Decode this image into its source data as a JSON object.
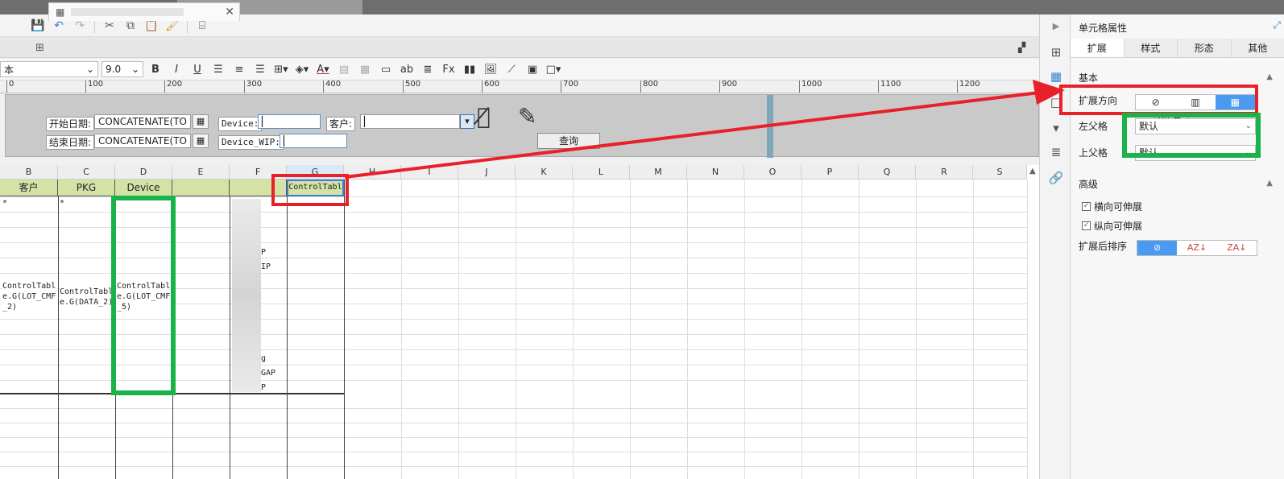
{
  "tab": {
    "title": ""
  },
  "toolbar": {
    "font_name": "本",
    "font_size": "9.0",
    "bold": "B",
    "italic": "I",
    "underline": "U"
  },
  "ruler": [
    "0",
    "100",
    "200",
    "300",
    "400",
    "500",
    "600",
    "700",
    "800",
    "900",
    "1000",
    "1100",
    "1200"
  ],
  "params": {
    "start_label": "开始日期:",
    "end_label": "结束日期:",
    "start_value": "CONCATENATE(TO",
    "end_value": "CONCATENATE(TO",
    "device_label": "Device:",
    "device_wip_label": "Device_WIP:",
    "customer_label": "客户:",
    "query_button": "查询"
  },
  "grid": {
    "columns": [
      "B",
      "C",
      "D",
      "E",
      "F",
      "G",
      "H",
      "I",
      "J",
      "K",
      "L",
      "M",
      "N",
      "O",
      "P",
      "Q",
      "R",
      "S"
    ],
    "header_cells": {
      "b": "客户",
      "c": "PKG",
      "d": "Device",
      "g": "ControlTabl"
    },
    "cell_b": "ControlTabl\ne.G(LOT_CMF\n_2)",
    "cell_c": "ControlTabl\ne.G(DATA_2)",
    "cell_d": "ControlTabl\ne.G(LOT_CMF\n_5)",
    "f_fragments": [
      "P",
      "IP",
      "g",
      "GAP",
      "P"
    ],
    "star": "*"
  },
  "side_panel": {
    "title": "单元格属性",
    "tabs": [
      "扩展",
      "样式",
      "形态",
      "其他"
    ],
    "basic_section": "基本",
    "expand_dir_label": "扩展方向",
    "left_parent_label": "左父格",
    "left_parent_value": "默认",
    "upper_parent_label": "上父格",
    "upper_parent_value": "默认",
    "tooltip_fragment": "向扩展",
    "advanced_section": "高级",
    "check_horizontal": "横向可伸展",
    "check_vertical": "纵向可伸展",
    "sort_label": "扩展后排序"
  },
  "colors": {
    "annotation_red": "#e8202a",
    "annotation_green": "#1ab34a",
    "accent_blue": "#4a9af2",
    "header_green": "#d3e3a6"
  },
  "icons": [
    "save-icon",
    "undo-icon",
    "redo-icon",
    "cut-icon",
    "copy-icon",
    "paste-icon",
    "format-brush-icon",
    "preview-icon",
    "eye-off-icon",
    "pencil-icon"
  ]
}
